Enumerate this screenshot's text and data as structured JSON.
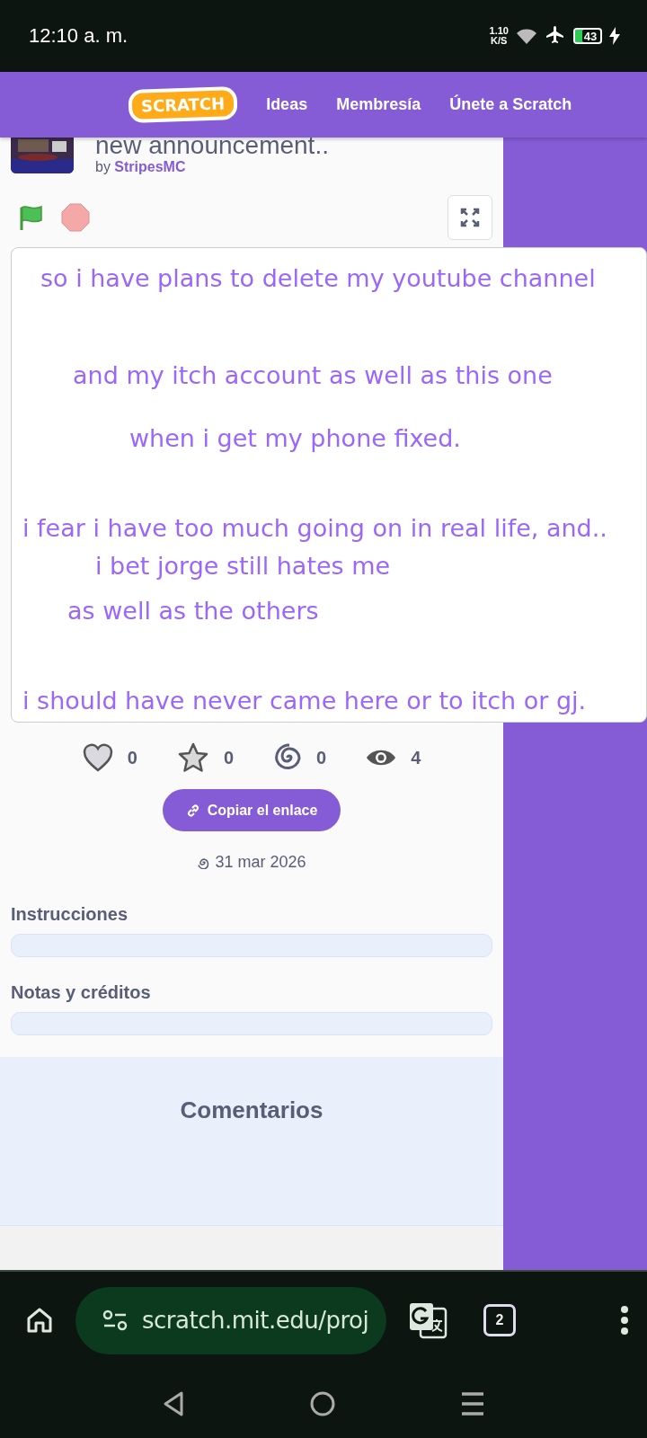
{
  "status_bar": {
    "time": "12:10 a. m.",
    "net_speed": "1.10",
    "net_unit": "K/S",
    "battery": "43"
  },
  "header": {
    "logo": "SCRATCH",
    "nav": [
      "Ideas",
      "Membresía",
      "Únete a Scratch"
    ]
  },
  "project": {
    "title": "new announcement..",
    "by": "by",
    "author": "StripesMC"
  },
  "stage": {
    "lines": [
      "so i have plans to delete my youtube channel",
      "and my itch account as well as this one",
      "when i get my phone fixed.",
      "i fear i have too much going on in real life, and..",
      "i bet jorge still hates me",
      "as well as the others",
      "i should have never came here or to itch or gj."
    ]
  },
  "stats": [
    {
      "kind": "love",
      "count": "0"
    },
    {
      "kind": "favorite",
      "count": "0"
    },
    {
      "kind": "remix",
      "count": "0"
    },
    {
      "kind": "views",
      "count": "4"
    }
  ],
  "copy_link": "Copiar el enlace",
  "date": "31 mar 2026",
  "sections": [
    "Instrucciones",
    "Notas y créditos"
  ],
  "comments_title": "Comentarios",
  "browser": {
    "url": "scratch.mit.edu/proj",
    "tabs": "2"
  }
}
